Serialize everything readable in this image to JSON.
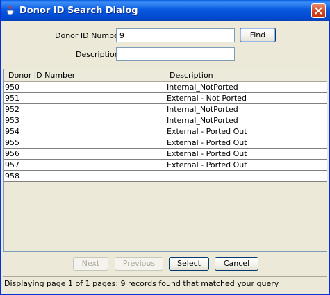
{
  "window": {
    "title": "Donor ID Search Dialog",
    "app_icon": "java-cup-icon",
    "close_icon": "close-icon"
  },
  "form": {
    "donor_id_label": "Donor ID Number",
    "donor_id_value": "9",
    "description_label": "Description",
    "description_value": "",
    "find_label": "Find"
  },
  "table": {
    "columns": [
      "Donor ID Number",
      "Description"
    ],
    "rows": [
      {
        "id": "950",
        "description": "Internal_NotPorted"
      },
      {
        "id": "951",
        "description": "External - Not Ported"
      },
      {
        "id": "952",
        "description": "Internal_NotPorted"
      },
      {
        "id": "953",
        "description": "Internal_NotPorted"
      },
      {
        "id": "954",
        "description": "External - Ported Out"
      },
      {
        "id": "955",
        "description": "External - Ported Out"
      },
      {
        "id": "956",
        "description": "External - Ported Out"
      },
      {
        "id": "957",
        "description": "External - Ported Out"
      },
      {
        "id": "958",
        "description": ""
      }
    ]
  },
  "buttons": {
    "next": "Next",
    "previous": "Previous",
    "select": "Select",
    "cancel": "Cancel"
  },
  "status": {
    "text": "Displaying page 1 of 1 pages:   9 records found that matched your query"
  },
  "colors": {
    "titlebar": "#0a5ae0",
    "dialog_bg": "#ece9d8",
    "close_button": "#d3411d"
  }
}
